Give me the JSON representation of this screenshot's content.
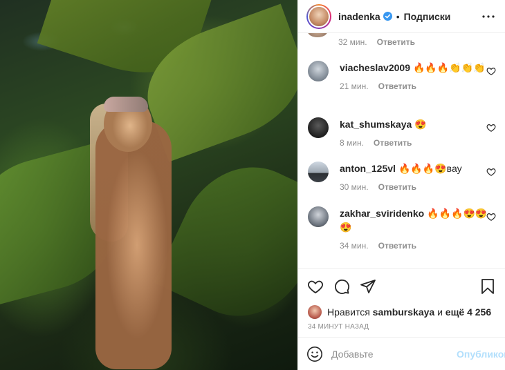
{
  "post": {
    "author": "inadenka",
    "follow_label": "Подписки",
    "separator": "•"
  },
  "comments_list": {
    "first_meta": {
      "time": "32 мин.",
      "reply": "Ответить"
    },
    "items": [
      {
        "user": "viacheslav2009",
        "text": "🔥🔥🔥👏👏👏",
        "time": "21 мин.",
        "reply": "Ответить"
      },
      {
        "user": "kat_shumskaya",
        "text": "😍",
        "time": "8 мин.",
        "reply": "Ответить"
      },
      {
        "user": "anton_125vl",
        "text": "🔥🔥🔥😍вау",
        "time": "30 мин.",
        "reply": "Ответить"
      },
      {
        "user": "zakhar_sviridenko",
        "text": "🔥🔥🔥😍😍😍",
        "time": "34 мин.",
        "reply": "Ответить"
      }
    ]
  },
  "likes": {
    "prefix": "Нравится",
    "user": "samburskaya",
    "middle": "и",
    "count": "ещё 4 256"
  },
  "timestamp": "34 МИНУТ НАЗАД",
  "add_comment": {
    "placeholder": "Добавьте",
    "publish_label": "Опубликовать"
  },
  "colors": {
    "verified": "#3897f0",
    "publish_disabled": "#b2dffc",
    "meta_text": "#8e8e8e"
  },
  "icons": {
    "header_more": "more-icon",
    "like": "heart-icon",
    "comment": "comment-icon",
    "share": "share-icon",
    "save": "bookmark-icon",
    "emoji": "emoji-icon"
  }
}
